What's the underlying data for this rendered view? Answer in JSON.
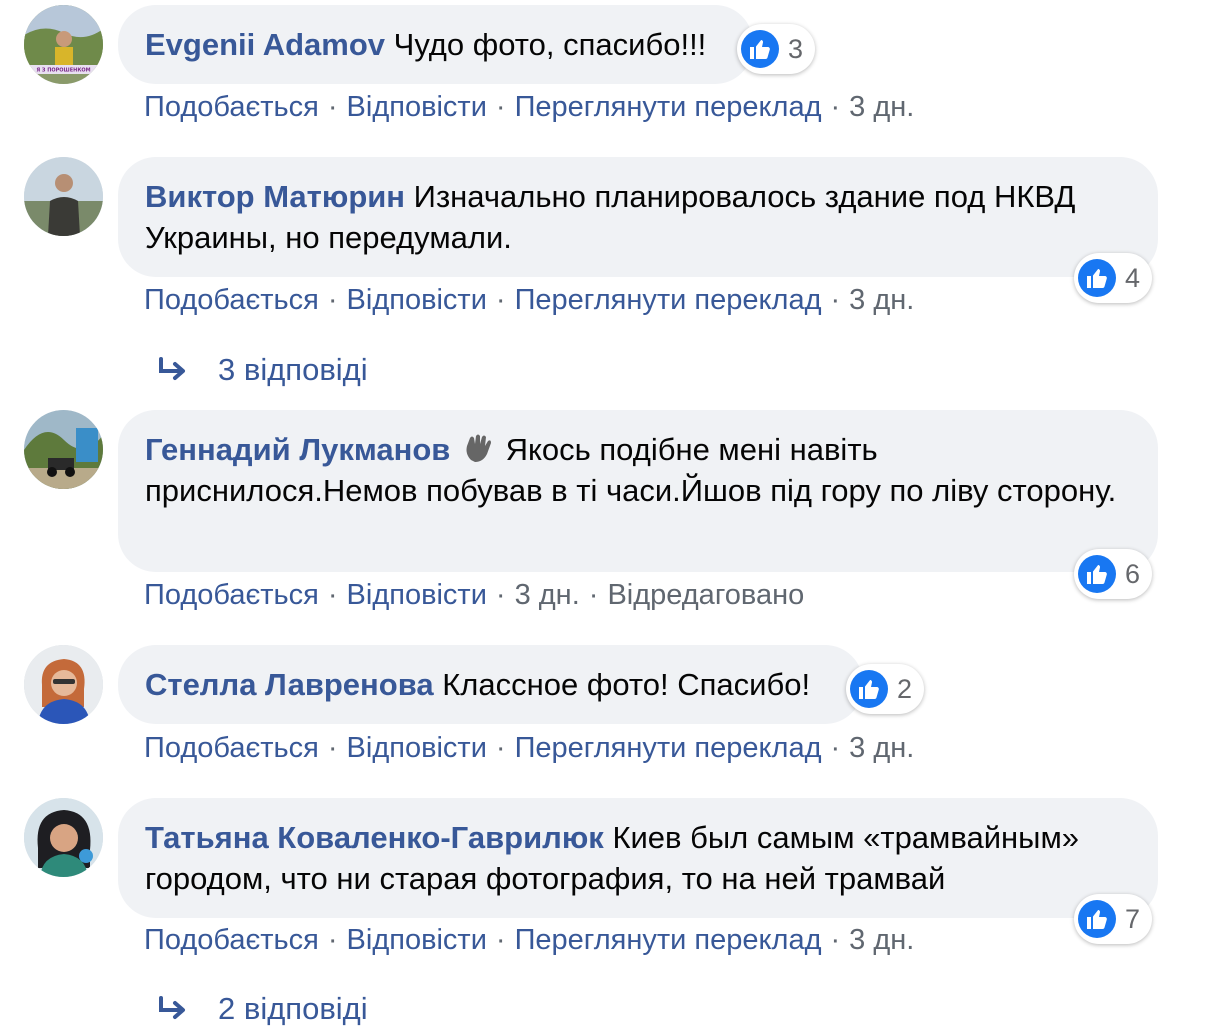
{
  "comments": [
    {
      "author": "Evgenii Adamov",
      "text": "Чудо фото, спасибо!!!",
      "likes": "3",
      "actions": {
        "like": "Подобається",
        "reply": "Відповісти",
        "translate": "Переглянути переклад",
        "time": "3 дн."
      }
    },
    {
      "author": "Виктор Матюрин",
      "text": "Изначально планировалось здание под НКВД Украины, но передумали.",
      "likes": "4",
      "actions": {
        "like": "Подобається",
        "reply": "Відповісти",
        "translate": "Переглянути переклад",
        "time": "3 дн."
      },
      "replies": "3 відповіді"
    },
    {
      "author": "Геннадий Лукманов",
      "text": "Якось подібне мені навіть приснилося.Немов побував в ті часи.Йшов під гору по ліву сторону.",
      "likes": "6",
      "actions": {
        "like": "Подобається",
        "reply": "Відповісти",
        "time": "3 дн.",
        "edited": "Відредаговано"
      }
    },
    {
      "author": "Стелла Лавренова",
      "text": "Классное фото! Спасибо!",
      "likes": "2",
      "actions": {
        "like": "Подобається",
        "reply": "Відповісти",
        "translate": "Переглянути переклад",
        "time": "3 дн."
      }
    },
    {
      "author": "Татьяна Коваленко-Гаврилюк",
      "text": "Киев был самым «трамвайным» городом, что ни старая фотография, то на ней трамвай",
      "likes": "7",
      "actions": {
        "like": "Подобається",
        "reply": "Відповісти",
        "translate": "Переглянути переклад",
        "time": "3 дн."
      },
      "replies": "2 відповіді"
    }
  ],
  "avatar_badge_text": "Я З ПОРОШЕНКОМ",
  "icons": {
    "like": "thumbs-up-icon",
    "reply_arrow": "reply-arrow-icon",
    "badge": "waving-hand-icon"
  },
  "colors": {
    "link": "#385898",
    "bubble": "#f0f2f5",
    "like_blue": "#1877f2",
    "meta_gray": "#606770"
  }
}
